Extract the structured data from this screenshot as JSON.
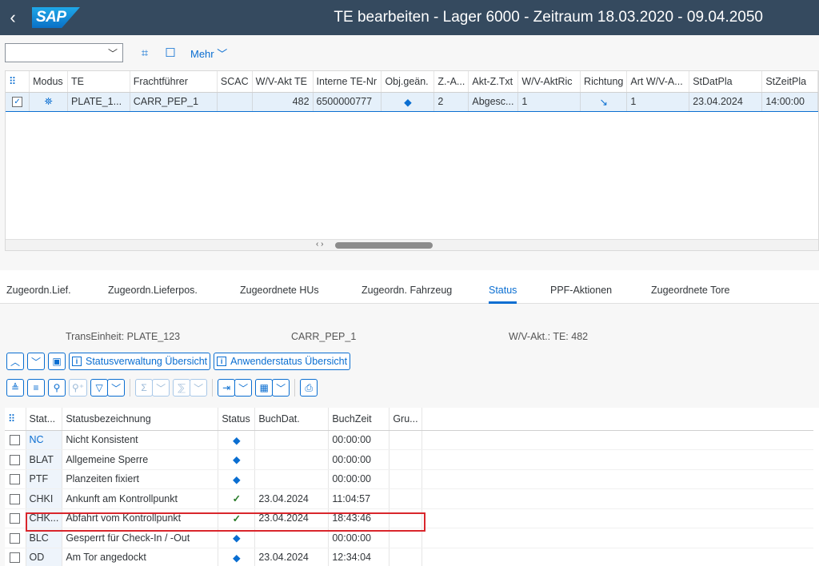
{
  "shell": {
    "logo_text": "SAP",
    "title": "TE bearbeiten - Lager 6000 - Zeitraum  18.03.2020 - 09.04.2050"
  },
  "toolbar": {
    "combo_value": "",
    "more_label": "Mehr"
  },
  "grid_te": {
    "columns": [
      "Modus",
      "TE",
      "Frachtführer",
      "SCAC",
      "W/V-Akt TE",
      "Interne TE-Nr",
      "Obj.geän.",
      "Z.-A...",
      "Akt-Z.Txt",
      "W/V-AktRic",
      "Richtung",
      "Art W/V-A...",
      "StDatPla",
      "StZeitPla"
    ],
    "row": {
      "modus": "⛯",
      "te": "PLATE_1...",
      "frachtfuehrer": "CARR_PEP_1",
      "scac": "",
      "wv_akt_te": "482",
      "interne_te_nr": "6500000777",
      "obj_geaen": "◆",
      "z_a": "2",
      "akt_z_txt": "Abgesc...",
      "wv_akt_ric": "1",
      "richtung": "↘",
      "art_wv_a": "1",
      "st_dat_pla": "23.04.2024",
      "st_zeit_pla": "14:00:00"
    }
  },
  "tabs": [
    {
      "label": "Zugeordn.Lief."
    },
    {
      "label": "Zugeordn.Lieferpos."
    },
    {
      "label": "Zugeordnete HUs"
    },
    {
      "label": "Zugeordn. Fahrzeug"
    },
    {
      "label": "Status"
    },
    {
      "label": "PPF-Aktionen"
    },
    {
      "label": "Zugeordnete Tore"
    }
  ],
  "info": {
    "transeinheit": "TransEinheit:  PLATE_123",
    "carrier": "CARR_PEP_1",
    "wv_akt": "W/V-Akt.: TE:  482"
  },
  "buttons": {
    "statusverwaltung": "Statusverwaltung Übersicht",
    "anwenderstatus": "Anwenderstatus Übersicht"
  },
  "grid_status": {
    "columns": [
      "Stat...",
      "Statusbezeichnung",
      "Status",
      "BuchDat.",
      "BuchZeit",
      "Gru..."
    ],
    "rows": [
      {
        "code": "NC",
        "desc": "Nicht Konsistent",
        "status": "◆",
        "date": "",
        "time": "00:00:00"
      },
      {
        "code": "BLAT",
        "desc": "Allgemeine Sperre",
        "status": "◆",
        "date": "",
        "time": "00:00:00"
      },
      {
        "code": "PTF",
        "desc": "Planzeiten fixiert",
        "status": "◆",
        "date": "",
        "time": "00:00:00"
      },
      {
        "code": "CHKI",
        "desc": "Ankunft am Kontrollpunkt",
        "status": "✓",
        "date": "23.04.2024",
        "time": "11:04:57"
      },
      {
        "code": "CHK...",
        "desc": "Abfahrt vom Kontrollpunkt",
        "status": "✓",
        "date": "23.04.2024",
        "time": "18:43:46"
      },
      {
        "code": "BLC",
        "desc": "Gesperrt für Check-In / -Out",
        "status": "◆",
        "date": "",
        "time": "00:00:00"
      },
      {
        "code": "OD",
        "desc": "Am Tor angedockt",
        "status": "◆",
        "date": "23.04.2024",
        "time": "12:34:04"
      }
    ]
  },
  "colors": {
    "shell": "#354a5f",
    "accent": "#0a6ed1",
    "highlight": "#d9262c",
    "success": "#2b7d2b"
  }
}
